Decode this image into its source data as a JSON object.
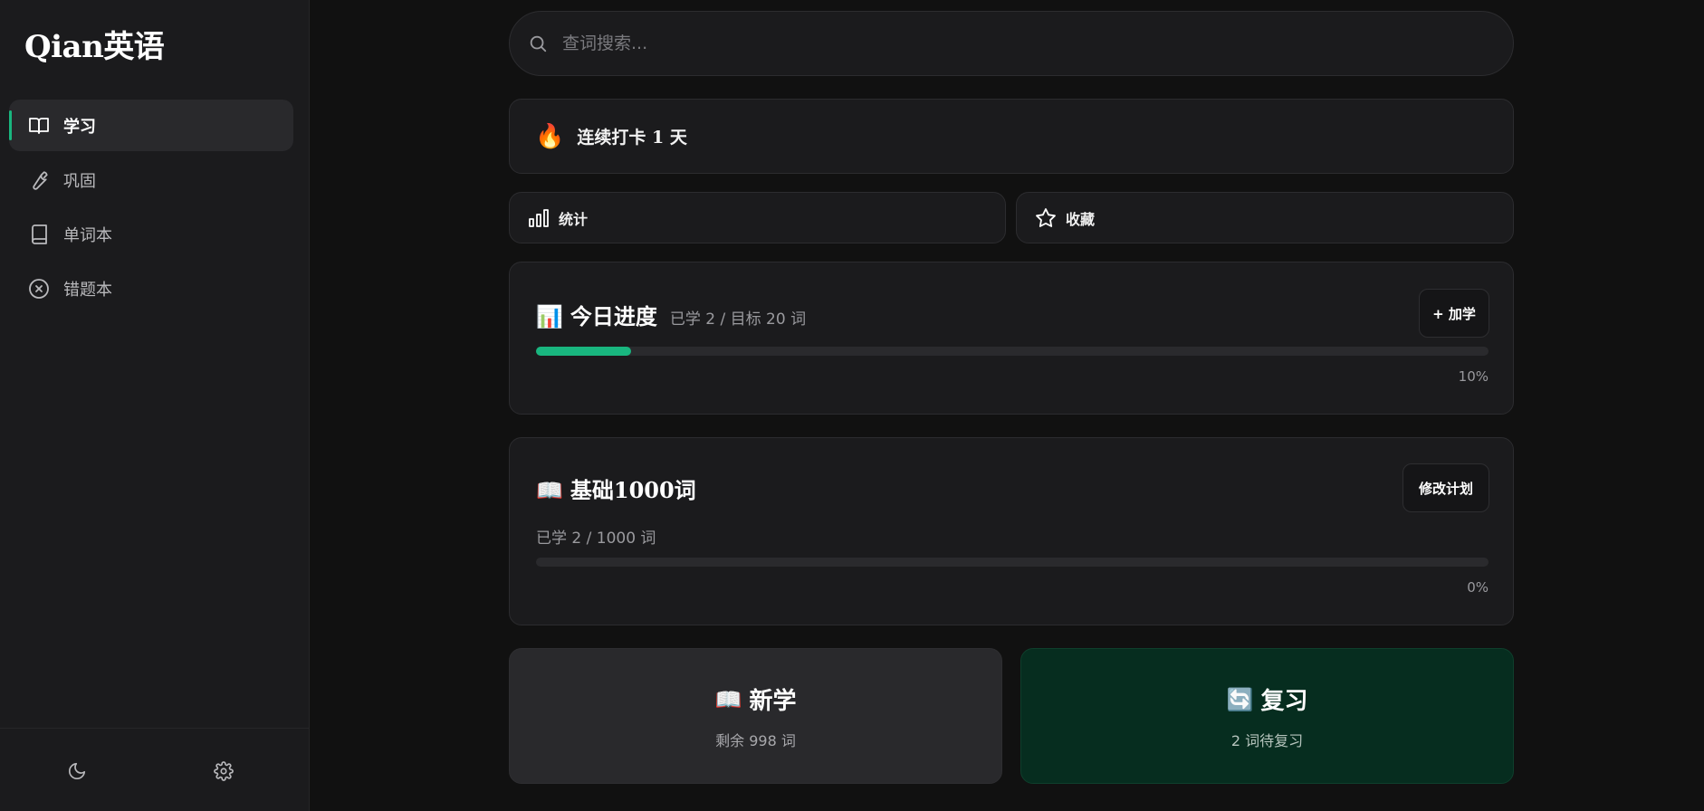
{
  "app": {
    "logo": "Qian英语"
  },
  "sidebar": {
    "items": [
      {
        "label": "学习",
        "icon": "book-open-icon",
        "active": true
      },
      {
        "label": "巩固",
        "icon": "wrench-icon",
        "active": false
      },
      {
        "label": "单词本",
        "icon": "notebook-icon",
        "active": false
      },
      {
        "label": "错题本",
        "icon": "x-circle-icon",
        "active": false
      }
    ],
    "footer": {
      "theme_icon": "moon-icon",
      "settings_icon": "gear-icon"
    }
  },
  "search": {
    "placeholder": "查词搜索..."
  },
  "streak": {
    "icon": "🔥",
    "text": "连续打卡 1 天"
  },
  "quick_links": {
    "stats_label": "统计",
    "favorites_label": "收藏"
  },
  "today": {
    "icon": "📊",
    "title": "今日进度",
    "subtitle": "已学 2 / 目标 20 词",
    "add_button": "+ 加学",
    "progress": 0.1,
    "percent_label": "10%"
  },
  "plan": {
    "icon": "📖",
    "title": "基础1000词",
    "subtitle": "已学 2 / 1000 词",
    "edit_button": "修改计划",
    "progress": 0.0,
    "percent_label": "0%"
  },
  "actions": {
    "learn": {
      "icon": "📖",
      "title": "新学",
      "subtitle": "剩余 998 词"
    },
    "review": {
      "icon": "🔄",
      "title": "复习",
      "subtitle": "2 词待复习"
    }
  },
  "colors": {
    "accent": "#19b67f",
    "review_bg": "#062d1f"
  }
}
